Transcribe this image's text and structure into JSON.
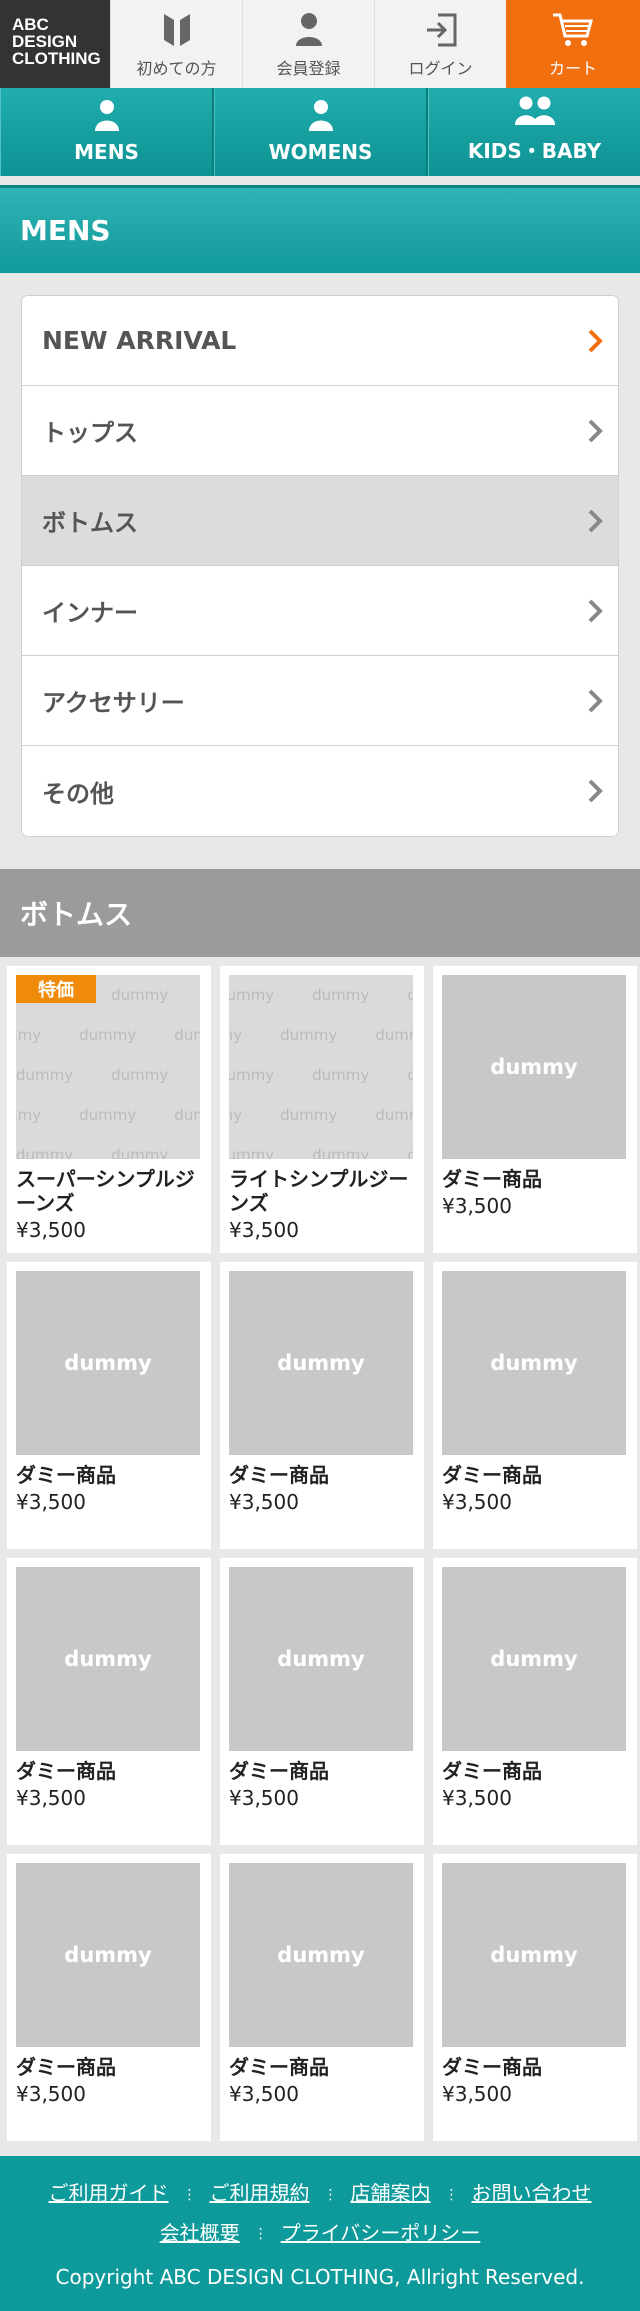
{
  "logo": {
    "line1": "ABC",
    "line2": "DESIGN",
    "line3": "CLOTHING"
  },
  "header_nav": [
    {
      "label": "初めての方",
      "icon": "bookmark-icon"
    },
    {
      "label": "会員登録",
      "icon": "person-icon"
    },
    {
      "label": "ログイン",
      "icon": "login-icon"
    },
    {
      "label": "カート",
      "icon": "cart-icon"
    }
  ],
  "category_nav": [
    {
      "label": "MENS",
      "icon": "person-icon"
    },
    {
      "label": "WOMENS",
      "icon": "person-icon"
    },
    {
      "label": "KIDS・BABY",
      "icon": "people-icon"
    }
  ],
  "section_title": "MENS",
  "submenu": [
    {
      "label": "NEW ARRIVAL"
    },
    {
      "label": "トップス"
    },
    {
      "label": "ボトムス"
    },
    {
      "label": "インナー"
    },
    {
      "label": "アクセサリー"
    },
    {
      "label": "その他"
    }
  ],
  "products_title": "ボトムス",
  "badge_label": "特価",
  "dummy_text": "dummy",
  "products": [
    {
      "name": "スーパーシンプルジーンズ",
      "price": "¥3,500"
    },
    {
      "name": "ライトシンプルジーンズ",
      "price": "¥3,500"
    },
    {
      "name": "ダミー商品",
      "price": "¥3,500"
    },
    {
      "name": "ダミー商品",
      "price": "¥3,500"
    },
    {
      "name": "ダミー商品",
      "price": "¥3,500"
    },
    {
      "name": "ダミー商品",
      "price": "¥3,500"
    },
    {
      "name": "ダミー商品",
      "price": "¥3,500"
    },
    {
      "name": "ダミー商品",
      "price": "¥3,500"
    },
    {
      "name": "ダミー商品",
      "price": "¥3,500"
    },
    {
      "name": "ダミー商品",
      "price": "¥3,500"
    },
    {
      "name": "ダミー商品",
      "price": "¥3,500"
    },
    {
      "name": "ダミー商品",
      "price": "¥3,500"
    }
  ],
  "footer": {
    "links_row1": [
      "ご利用ガイド",
      "ご利用規約",
      "店舗案内",
      "お問い合わせ"
    ],
    "links_row2": [
      "会社概要",
      "プライバシーポリシー"
    ],
    "copyright": "Copyright ABC DESIGN CLOTHING, Allright Reserved."
  },
  "colors": {
    "teal": "#0e9a9b",
    "orange": "#f26f0f",
    "badge": "#f08a0a",
    "gray_heading": "#9b9b9b"
  }
}
